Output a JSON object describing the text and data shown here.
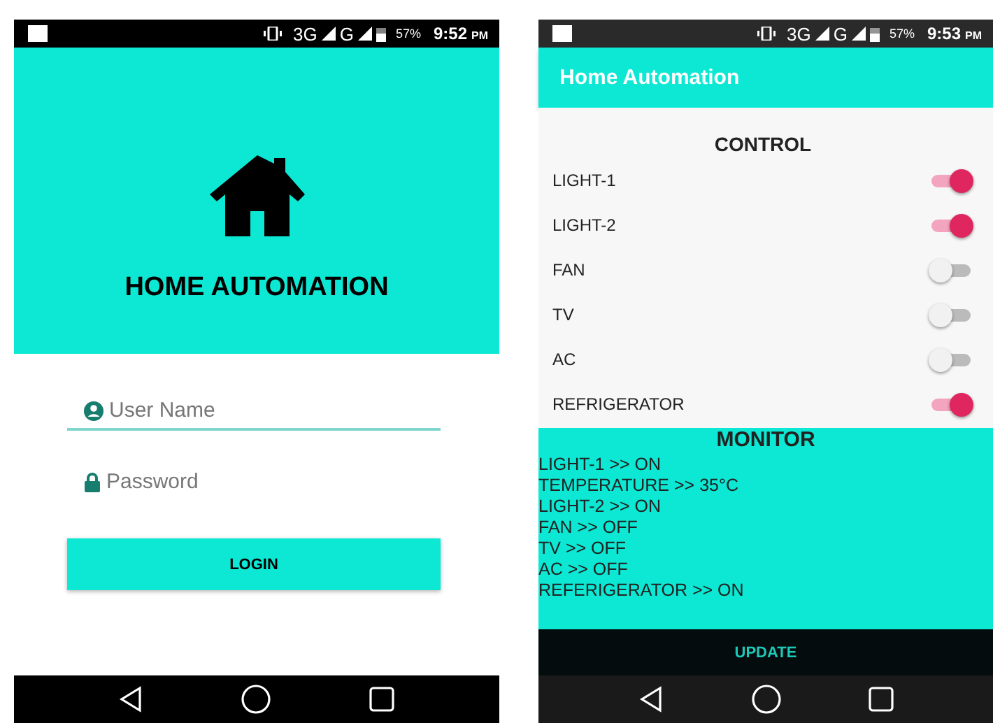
{
  "screens": [
    {
      "kind": "login",
      "status_bar": {
        "network": "3G",
        "network2": "G",
        "battery": "57%",
        "time": "9:52",
        "ampm": "PM"
      },
      "title": "HOME AUTOMATION",
      "username": {
        "placeholder": "User Name"
      },
      "password": {
        "placeholder": "Password"
      },
      "login_button": "LOGIN"
    },
    {
      "kind": "control",
      "status_bar": {
        "network": "3G",
        "network2": "G",
        "battery": "57%",
        "time": "9:53",
        "ampm": "PM"
      },
      "app_title": "Home Automation",
      "control_heading": "CONTROL",
      "switches": [
        {
          "label": "LIGHT-1",
          "on": true
        },
        {
          "label": "LIGHT-2",
          "on": true
        },
        {
          "label": "FAN",
          "on": false
        },
        {
          "label": "TV",
          "on": false
        },
        {
          "label": "AC",
          "on": false
        },
        {
          "label": "REFRIGERATOR",
          "on": true
        }
      ],
      "monitor_heading": "MONITOR",
      "monitor_lines": [
        "LIGHT-1 >> ON",
        "TEMPERATURE >> 35°C",
        "LIGHT-2 >> ON",
        "FAN >> OFF",
        "TV >> OFF",
        "AC >> OFF",
        "REFERIGERATOR >> ON"
      ],
      "update_button": "UPDATE"
    }
  ]
}
